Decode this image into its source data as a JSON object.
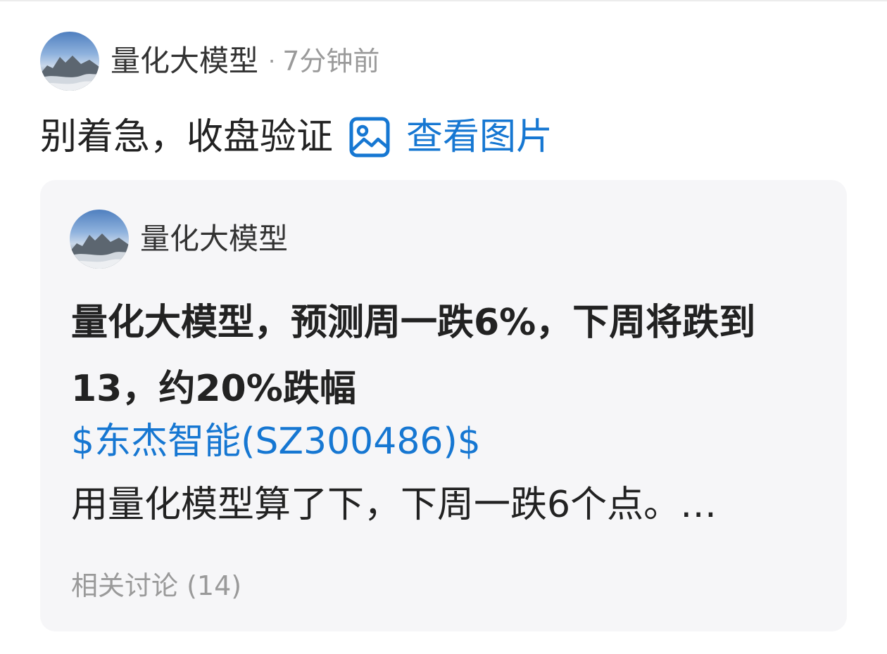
{
  "post": {
    "author": "量化大模型",
    "separator": "·",
    "time": "7分钟前",
    "text": "别着急，收盘验证",
    "view_image_label": "查看图片",
    "icons": {
      "avatar": "landscape-avatar",
      "image": "image-icon"
    }
  },
  "quote": {
    "author": "量化大模型",
    "title": "量化大模型，预测周一跌6%，下周将跌到13，约20%跌幅",
    "stock_tag": "$东杰智能(SZ300486)$",
    "excerpt": "用量化模型算了下，下周一跌6个点。…",
    "related": "相关讨论 (14)"
  },
  "colors": {
    "link": "#1677d2",
    "text": "#222222",
    "muted": "#9a9a9a",
    "card_background": "#f6f6f8"
  }
}
